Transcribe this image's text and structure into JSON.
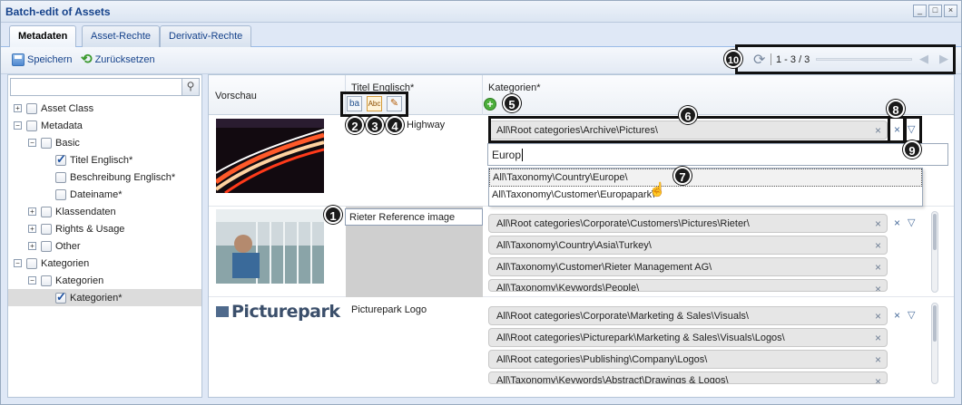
{
  "window": {
    "title": "Batch-edit of Assets",
    "controls": [
      "_",
      "□",
      "×"
    ]
  },
  "tabs": [
    {
      "label": "Metadaten",
      "active": true
    },
    {
      "label": "Asset-Rechte",
      "active": false
    },
    {
      "label": "Derivativ-Rechte",
      "active": false
    }
  ],
  "toolbar": {
    "save_label": "Speichern",
    "reset_label": "Zurücksetzen"
  },
  "pager": {
    "count": "1 - 3 / 3"
  },
  "search": {
    "placeholder": ""
  },
  "tree": [
    {
      "label": "Asset Class",
      "expander": "+",
      "checked": false
    },
    {
      "label": "Metadata",
      "expander": "−",
      "checked": false
    },
    {
      "label": "Basic",
      "expander": "−",
      "checked": false
    },
    {
      "label": "Titel Englisch*",
      "expander": "",
      "checked": true
    },
    {
      "label": "Beschreibung Englisch*",
      "expander": "",
      "checked": false
    },
    {
      "label": "Dateiname*",
      "expander": "",
      "checked": false
    },
    {
      "label": "Klassendaten",
      "expander": "+",
      "checked": false
    },
    {
      "label": "Rights & Usage",
      "expander": "+",
      "checked": false
    },
    {
      "label": "Other",
      "expander": "+",
      "checked": false
    },
    {
      "label": "Kategorien",
      "expander": "−",
      "checked": false
    },
    {
      "label": "Kategorien",
      "expander": "−",
      "checked": false
    },
    {
      "label": "Kategorien*",
      "expander": "",
      "checked": true
    }
  ],
  "grid": {
    "headers": {
      "preview": "Vorschau",
      "title": "Titel Englisch*",
      "categories": "Kategorien*"
    },
    "rows": [
      {
        "title": "Highway",
        "categories": [
          "All\\Root categories\\Archive\\Pictures\\"
        ],
        "input_value": "Europ"
      },
      {
        "title": "Rieter Reference image",
        "categories": [
          "All\\Root categories\\Corporate\\Customers\\Pictures\\Rieter\\",
          "All\\Taxonomy\\Country\\Asia\\Turkey\\",
          "All\\Taxonomy\\Customer\\Rieter Management AG\\",
          "All\\Taxonomy\\Keywords\\People\\"
        ]
      },
      {
        "title": "Picturepark Logo",
        "logo_text": "Picturepark",
        "categories": [
          "All\\Root categories\\Corporate\\Marketing & Sales\\Visuals\\",
          "All\\Root categories\\Picturepark\\Marketing & Sales\\Visuals\\Logos\\",
          "All\\Root categories\\Publishing\\Company\\Logos\\",
          "All\\Taxonomy\\Keywords\\Abstract\\Drawings & Logos\\"
        ]
      }
    ]
  },
  "suggestions": [
    "All\\Taxonomy\\Country\\Europe\\",
    "All\\Taxonomy\\Customer\\Europapark\\"
  ],
  "callouts": [
    "1",
    "2",
    "3",
    "4",
    "5",
    "6",
    "7",
    "8",
    "9",
    "10"
  ],
  "icons": {
    "remove": "×",
    "more": "▽",
    "add": "+",
    "refresh": "⟳",
    "search": "⚲"
  }
}
